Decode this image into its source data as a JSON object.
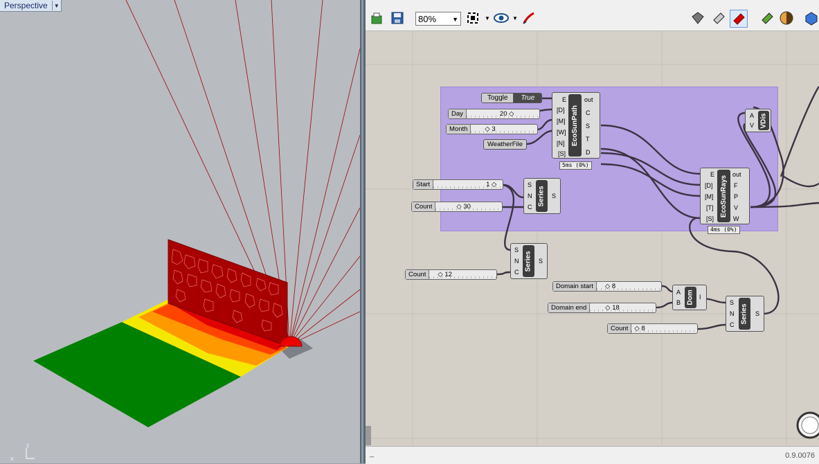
{
  "viewport": {
    "tab_label": "Perspective",
    "axis_z": "z",
    "axis_x": "x"
  },
  "toolbar": {
    "zoom_value": "80%",
    "icons": [
      "open-file-icon",
      "save-icon",
      "zoom-dropdown",
      "zoom-extents-icon",
      "preview-eye-icon",
      "sketch-icon",
      "wire-display-icon",
      "shaded-display-icon",
      "selected-display-icon",
      "bake-icon",
      "material-icon",
      "sphere-icon"
    ]
  },
  "canvas": {
    "toggle": {
      "label": "Toggle",
      "value": "True"
    },
    "sliders": {
      "day": {
        "label": "Day",
        "value": "20"
      },
      "month": {
        "label": "Month",
        "value": "3"
      },
      "start": {
        "label": "Start",
        "value": "1"
      },
      "count1": {
        "label": "Count",
        "value": "30"
      },
      "count2": {
        "label": "Count",
        "value": "12"
      },
      "domain_start": {
        "label": "Domain start",
        "value": "8"
      },
      "domain_end": {
        "label": "Domain end",
        "value": "18"
      },
      "count3": {
        "label": "Count",
        "value": "8"
      }
    },
    "weatherfile": "WeatherFile",
    "ecosunpath": {
      "name": "EcoSunPath",
      "inputs": [
        "E",
        "[D]",
        "[M]",
        "[W]",
        "[N]",
        "[S]"
      ],
      "outputs": [
        "out",
        "C",
        "S",
        "T",
        "D"
      ],
      "timing": "5ms (0%)"
    },
    "ecosunrays": {
      "name": "EcoSunRays",
      "inputs": [
        "E",
        "[D]",
        "[M]",
        "[T]",
        "[S]"
      ],
      "outputs": [
        "out",
        "F",
        "P",
        "V",
        "W"
      ],
      "timing": "4ms (0%)"
    },
    "series1": {
      "name": "Series",
      "inputs": [
        "S",
        "N",
        "C"
      ],
      "output": "S"
    },
    "series2": {
      "name": "Series",
      "inputs": [
        "S",
        "N",
        "C"
      ],
      "output": "S"
    },
    "series3": {
      "name": "Series",
      "inputs": [
        "S",
        "N",
        "C"
      ],
      "output": "S"
    },
    "dom": {
      "name": "Dom",
      "inputs": [
        "A",
        "B"
      ],
      "output": "I"
    },
    "vdis": {
      "name": "VDis",
      "inputs": [
        "A",
        "V"
      ]
    }
  },
  "status": {
    "left": "_",
    "version": "0.9.0076"
  },
  "colors": {
    "group": "#b6a3e4",
    "canvas": "#d4d0c8",
    "wire": "#3b3342",
    "ground_green": "#008000",
    "sun_red": "#ee0000"
  }
}
